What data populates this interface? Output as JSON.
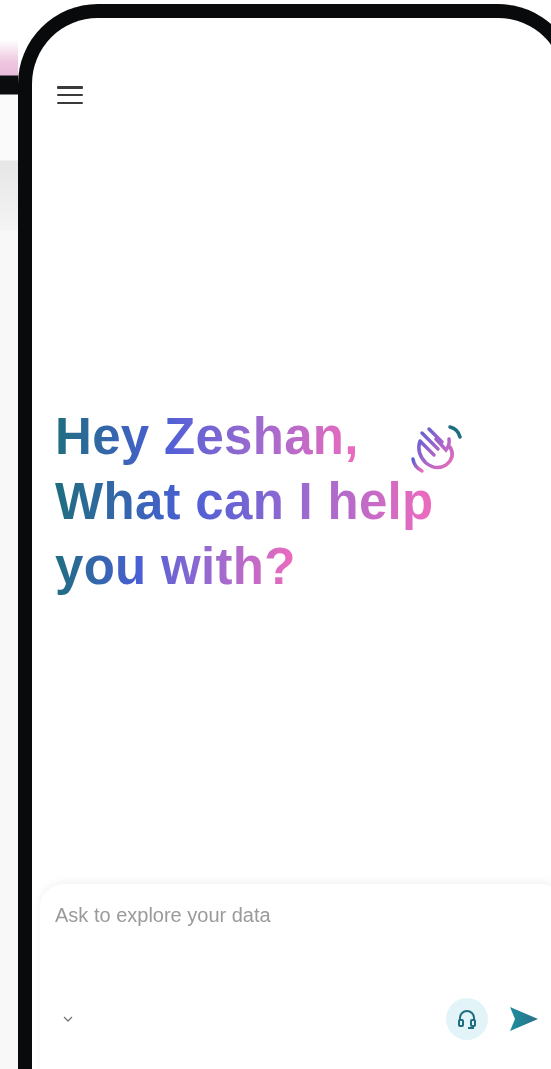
{
  "greeting": {
    "lines": [
      "Hey Zeshan,",
      "What can I help",
      "you with?"
    ]
  },
  "composer": {
    "placeholder": "Ask to explore your data"
  }
}
